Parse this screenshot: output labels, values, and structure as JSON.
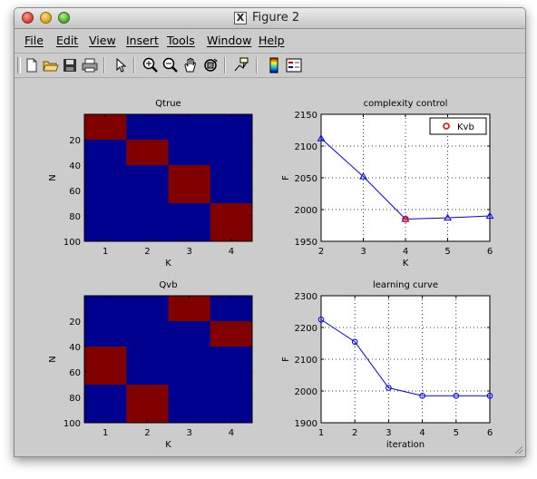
{
  "window": {
    "title": "Figure 2"
  },
  "menu": [
    "File",
    "Edit",
    "View",
    "Insert",
    "Tools",
    "Window",
    "Help"
  ],
  "toolbar": [
    "new-file-icon",
    "open-folder-icon",
    "save-icon",
    "print-icon",
    "pointer-icon",
    "zoom-in-icon",
    "zoom-out-icon",
    "pan-hand-icon",
    "rotate-3d-icon",
    "data-cursor-icon",
    "colorbar-icon",
    "legend-icon"
  ],
  "colors": {
    "blue": "#00008f",
    "red": "#800000",
    "line": "#0000ff",
    "marker_red": "#ff0000"
  },
  "chart_data": [
    {
      "type": "heatmap",
      "title": "Qtrue",
      "xlabel": "K",
      "ylabel": "N",
      "xticks": [
        1,
        2,
        3,
        4
      ],
      "yticks": [
        20,
        40,
        60,
        80,
        100
      ],
      "ylim": [
        0,
        100
      ],
      "blocks": [
        {
          "col": 1,
          "from": 0,
          "to": 20
        },
        {
          "col": 2,
          "from": 20,
          "to": 40
        },
        {
          "col": 3,
          "from": 40,
          "to": 70
        },
        {
          "col": 4,
          "from": 70,
          "to": 100
        }
      ]
    },
    {
      "type": "line",
      "title": "complexity control",
      "xlabel": "K",
      "ylabel": "F",
      "x": [
        2,
        3,
        4,
        5,
        6
      ],
      "series": [
        {
          "name": "",
          "values": [
            2112,
            2052,
            1985,
            1987,
            1990
          ],
          "marker": "triangle"
        },
        {
          "name": "Kvb",
          "x": [
            4
          ],
          "values": [
            1985
          ],
          "marker": "circle",
          "color": "red"
        }
      ],
      "xlim": [
        2,
        6
      ],
      "ylim": [
        1950,
        2150
      ],
      "yticks": [
        1950,
        2000,
        2050,
        2100,
        2150
      ],
      "grid": true,
      "legend": "top-right"
    },
    {
      "type": "heatmap",
      "title": "Qvb",
      "xlabel": "K",
      "ylabel": "N",
      "xticks": [
        1,
        2,
        3,
        4
      ],
      "yticks": [
        20,
        40,
        60,
        80,
        100
      ],
      "ylim": [
        0,
        100
      ],
      "blocks": [
        {
          "col": 3,
          "from": 0,
          "to": 20
        },
        {
          "col": 4,
          "from": 20,
          "to": 40
        },
        {
          "col": 1,
          "from": 40,
          "to": 70
        },
        {
          "col": 2,
          "from": 70,
          "to": 100
        }
      ]
    },
    {
      "type": "line",
      "title": "learning curve",
      "xlabel": "iteration",
      "ylabel": "F",
      "x": [
        1,
        2,
        3,
        4,
        5,
        6
      ],
      "series": [
        {
          "name": "",
          "values": [
            2225,
            2155,
            2010,
            1985,
            1985,
            1985
          ],
          "marker": "circle"
        }
      ],
      "xlim": [
        1,
        6
      ],
      "ylim": [
        1900,
        2300
      ],
      "yticks": [
        1900,
        2000,
        2100,
        2200,
        2300
      ],
      "grid": true
    }
  ]
}
